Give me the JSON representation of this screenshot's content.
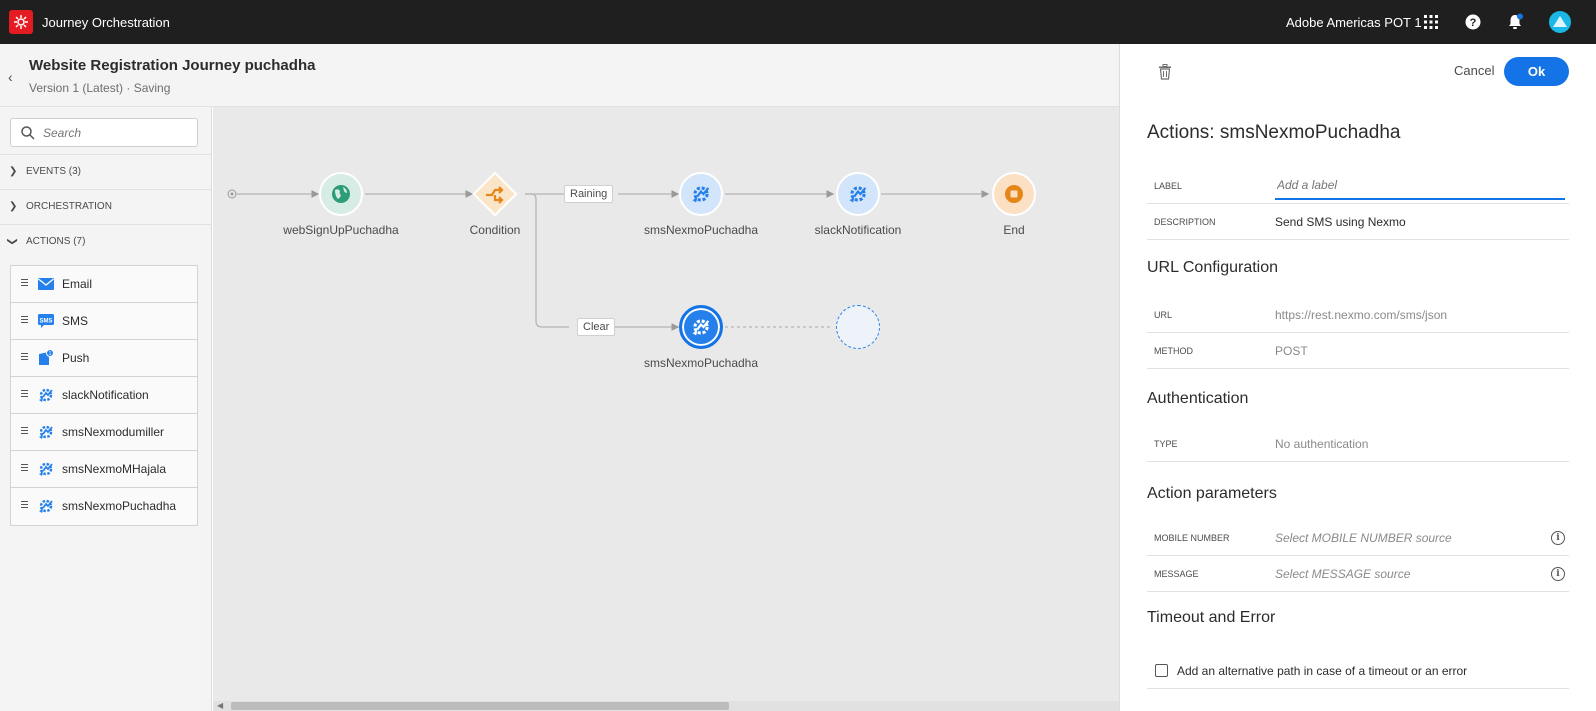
{
  "topbar": {
    "app_title": "Journey Orchestration",
    "org_name": "Adobe Americas POT 1"
  },
  "journey": {
    "title": "Website Registration Journey puchadha",
    "version": "Version 1 (Latest) · Saving"
  },
  "palette": {
    "search_placeholder": "Search",
    "sections": [
      {
        "label": "EVENTS (3)"
      },
      {
        "label": "ORCHESTRATION"
      },
      {
        "label": "ACTIONS (7)"
      }
    ],
    "actions": [
      {
        "label": "Email",
        "icon": "email-icon"
      },
      {
        "label": "SMS",
        "icon": "sms-icon"
      },
      {
        "label": "Push",
        "icon": "push-icon"
      },
      {
        "label": "slackNotification",
        "icon": "custom-action-icon"
      },
      {
        "label": "smsNexmodumiller",
        "icon": "custom-action-icon"
      },
      {
        "label": "smsNexmoMHajala",
        "icon": "custom-action-icon"
      },
      {
        "label": "smsNexmoPuchadha",
        "icon": "custom-action-icon"
      }
    ]
  },
  "canvas": {
    "nodes": [
      {
        "label": "webSignUpPuchadha",
        "type": "event",
        "icon": "globe-icon"
      },
      {
        "label": "Condition",
        "type": "condition",
        "icon": "condition-icon"
      },
      {
        "label": "smsNexmoPuchadha",
        "type": "action",
        "icon": "custom-action-icon"
      },
      {
        "label": "slackNotification",
        "type": "action",
        "icon": "custom-action-icon"
      },
      {
        "label": "End",
        "type": "end",
        "icon": "stop-icon"
      },
      {
        "label": "smsNexmoPuchadha",
        "type": "action-selected",
        "icon": "custom-action-icon"
      }
    ],
    "edge_labels": [
      "Raining",
      "Clear"
    ]
  },
  "panel": {
    "cancel_label": "Cancel",
    "ok_label": "Ok",
    "title": "Actions: smsNexmoPuchadha",
    "label_field": {
      "label": "LABEL",
      "placeholder": "Add a label"
    },
    "description_field": {
      "label": "DESCRIPTION",
      "value": "Send SMS using Nexmo"
    },
    "url_config": {
      "title": "URL Configuration",
      "url": {
        "label": "URL",
        "value": "https://rest.nexmo.com/sms/json"
      },
      "method": {
        "label": "METHOD",
        "value": "POST"
      }
    },
    "authentication": {
      "title": "Authentication",
      "type": {
        "label": "TYPE",
        "value": "No authentication"
      }
    },
    "action_parameters": {
      "title": "Action parameters",
      "mobile": {
        "label": "MOBILE NUMBER",
        "value": "Select MOBILE NUMBER source"
      },
      "message": {
        "label": "MESSAGE",
        "value": "Select MESSAGE source"
      }
    },
    "timeout": {
      "title": "Timeout and Error",
      "checkbox_label": "Add an alternative path in case of a timeout or an error"
    }
  },
  "colors": {
    "topbar_bg": "#1f1f1f",
    "accent": "#1473e6",
    "brand_red": "#e51b23",
    "event_node": "#2d9d78",
    "condition_node": "#e68619",
    "end_node": "#e68619"
  }
}
